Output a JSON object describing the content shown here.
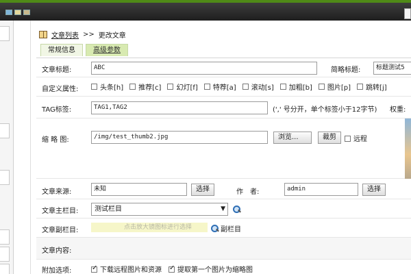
{
  "breadcrumb": {
    "list_label": "文章列表",
    "separator": ">>",
    "current": "更改文章"
  },
  "tabs": [
    {
      "label": "常规信息"
    },
    {
      "label": "高级参数"
    }
  ],
  "form": {
    "title_label": "文章标题:",
    "title_value": "ABC",
    "short_title_label": "简略标题:",
    "short_title_value": "标题测试5",
    "attr_label": "自定义属性:",
    "attrs": [
      {
        "label": "头条[h]"
      },
      {
        "label": "推荐[c]"
      },
      {
        "label": "幻灯[f]"
      },
      {
        "label": "特荐[a]"
      },
      {
        "label": "滚动[s]"
      },
      {
        "label": "加粗[b]"
      },
      {
        "label": "图片[p]"
      },
      {
        "label": "跳转[j]"
      }
    ],
    "tag_label": "TAG标签:",
    "tag_value": "TAG1,TAG2",
    "tag_hint": "(',' 号分开，单个标签小于12字节)",
    "weight_label": "权重:",
    "thumb_label": "缩 略 图:",
    "thumb_value": "/img/test_thumb2.jpg",
    "browse_button": "浏览...",
    "crop_button": "裁剪",
    "remote_label": "远程",
    "source_label": "文章来源:",
    "source_value": "未知",
    "source_select_button": "选择",
    "author_label": "作　者:",
    "author_value": "admin",
    "author_select_button": "选择",
    "main_col_label": "文章主栏目:",
    "main_col_value": "测试栏目",
    "sub_col_label": "文章副栏目:",
    "sub_col_placeholder": "点击放大镜图标进行选择",
    "sub_col_button": "副栏目",
    "content_label": "文章内容:",
    "extra_label": "附加选项:",
    "extra_opt1": "下载远程图片和资源",
    "extra_opt2": "提取第一个图片为缩略图"
  }
}
